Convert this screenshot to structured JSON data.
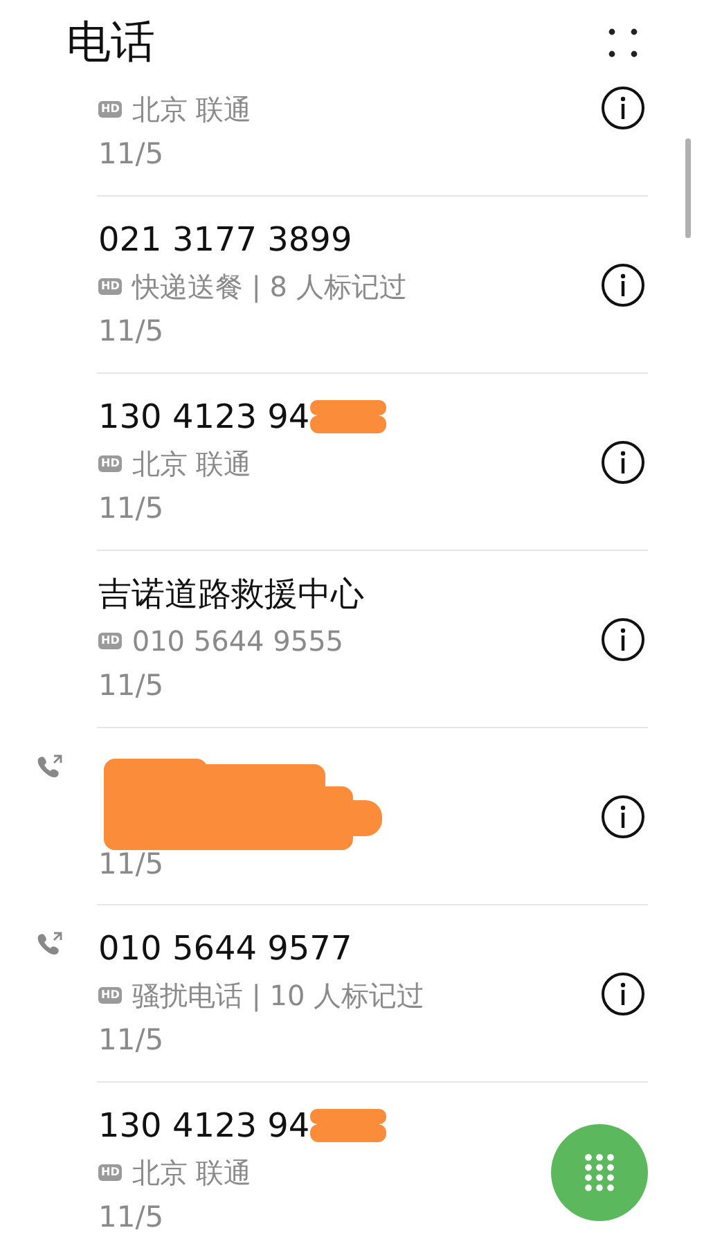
{
  "title": "电话",
  "calls": [
    {
      "kind": "plain",
      "badge": "HD",
      "detail": "北京 联通",
      "date": "11/5",
      "outgoing": false,
      "info_button": true
    },
    {
      "kind": "plain",
      "number": "021 3177 3899",
      "badge": "HD",
      "detail": "快递送餐 | 8 人标记过",
      "date": "11/5",
      "outgoing": false,
      "info_button": true
    },
    {
      "kind": "tail_redacted",
      "number": "130 4123 94",
      "badge": "HD",
      "detail": "北京 联通",
      "date": "11/5",
      "outgoing": false,
      "info_button": true
    },
    {
      "kind": "plain",
      "number": "吉诺道路救援中心",
      "badge": "HD",
      "detail": "010 5644 9555",
      "date": "11/5",
      "outgoing": false,
      "info_button": true
    },
    {
      "kind": "redacted",
      "date": "11/5",
      "outgoing": true,
      "info_button": true
    },
    {
      "kind": "plain",
      "number": "010 5644 9577",
      "badge": "HD",
      "detail": "骚扰电话 | 10 人标记过",
      "date": "11/5",
      "outgoing": true,
      "info_button": true
    },
    {
      "kind": "tail_redacted",
      "number": "130 4123 94",
      "badge": "HD",
      "detail": "北京 联通",
      "date": "11/5",
      "outgoing": false,
      "info_button": false
    }
  ]
}
